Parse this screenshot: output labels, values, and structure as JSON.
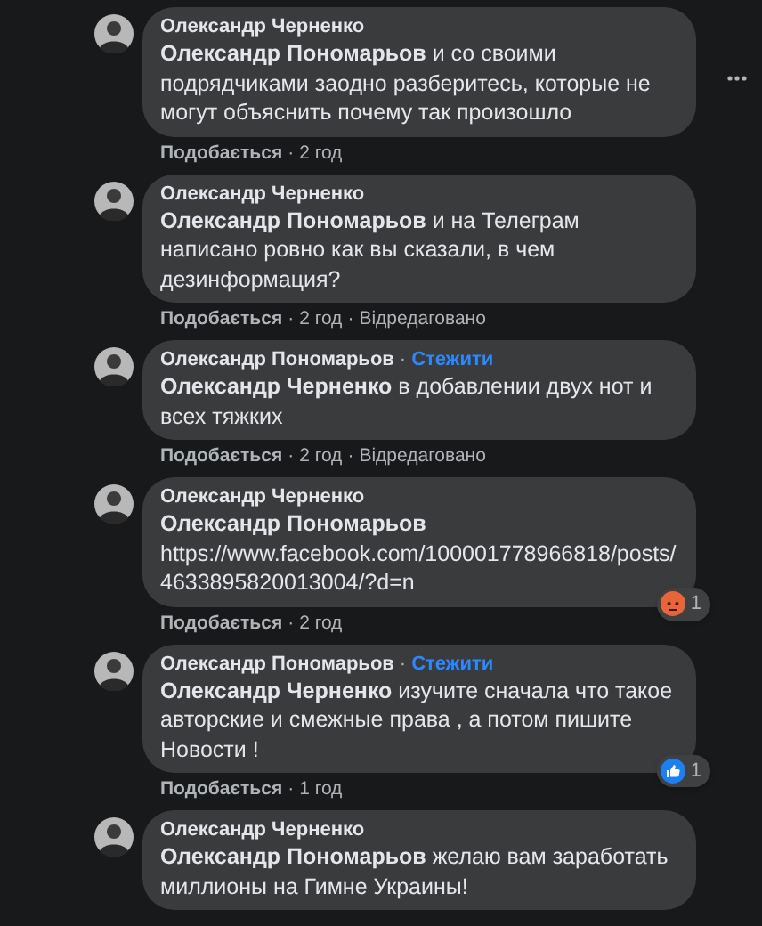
{
  "comments": [
    {
      "author": "Олександр Черненко",
      "text": "**Олександр Пономарьов** и со своими подрядчиками заодно разберитесь, которые не могут объяснить почему так произошло",
      "meta": [
        {
          "kind": "like",
          "text": "Подобається"
        },
        {
          "kind": "dot",
          "text": "·"
        },
        {
          "kind": "time",
          "text": "2 год"
        }
      ],
      "more": true
    },
    {
      "author": "Олександр Черненко",
      "text": "**Олександр Пономарьов** и на Телеграм написано ровно как вы сказали, в чем дезинформация?",
      "meta": [
        {
          "kind": "like",
          "text": "Подобається"
        },
        {
          "kind": "dot",
          "text": "·"
        },
        {
          "kind": "time",
          "text": "2 год"
        },
        {
          "kind": "dot",
          "text": "·"
        },
        {
          "kind": "edited",
          "text": "Відредаговано"
        }
      ],
      "more": false
    },
    {
      "author": "Олександр Пономарьов",
      "follow": {
        "dot": "·",
        "label": "Стежити"
      },
      "text": "**Олександр Черненко** в добавлении двух нот и всех тяжких",
      "meta": [
        {
          "kind": "like",
          "text": "Подобається"
        },
        {
          "kind": "dot",
          "text": "·"
        },
        {
          "kind": "time",
          "text": "2 год"
        },
        {
          "kind": "dot",
          "text": "·"
        },
        {
          "kind": "edited",
          "text": "Відредаговано"
        }
      ],
      "more": false
    },
    {
      "author": "Олександр Черненко",
      "text": "**Олександр Пономарьов** https://www.facebook.com/100001778966818/posts/4633895820013004/?d=n",
      "meta": [
        {
          "kind": "like",
          "text": "Подобається"
        },
        {
          "kind": "dot",
          "text": "·"
        },
        {
          "kind": "time",
          "text": "2 год"
        }
      ],
      "reaction": {
        "kind": "angry",
        "count": "1"
      },
      "more": false
    },
    {
      "author": "Олександр Пономарьов",
      "follow": {
        "dot": "·",
        "label": "Стежити"
      },
      "text": "**Олександр Черненко** изучите сначала что такое авторские и смежные права , а потом пишите Новости !",
      "meta": [
        {
          "kind": "like",
          "text": "Подобається"
        },
        {
          "kind": "dot",
          "text": "·"
        },
        {
          "kind": "time",
          "text": "1 год"
        }
      ],
      "reaction": {
        "kind": "like",
        "count": "1"
      },
      "more": false
    },
    {
      "author": "Олександр Черненко",
      "text": "**Олександр Пономарьов** желаю вам заработать миллионы на Гимне Украины!",
      "more": false
    }
  ]
}
